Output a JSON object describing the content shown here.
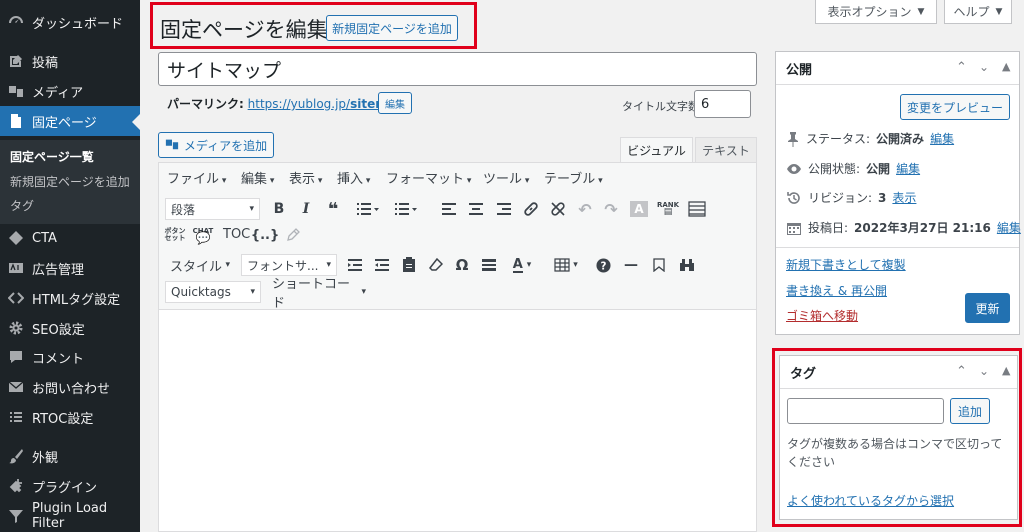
{
  "sidebar": {
    "items": [
      {
        "label": "ダッシュボード",
        "icon": "dashboard-icon"
      },
      {
        "label": "投稿",
        "icon": "posts-icon"
      },
      {
        "label": "メディア",
        "icon": "media-icon"
      },
      {
        "label": "固定ページ",
        "icon": "pages-icon"
      },
      {
        "label": "CTA",
        "icon": "cta-icon"
      },
      {
        "label": "広告管理",
        "icon": "ad-icon"
      },
      {
        "label": "HTMLタグ設定",
        "icon": "code-icon"
      },
      {
        "label": "SEO設定",
        "icon": "gear-icon"
      },
      {
        "label": "コメント",
        "icon": "comment-icon"
      },
      {
        "label": "お問い合わせ",
        "icon": "mail-icon"
      },
      {
        "label": "RTOC設定",
        "icon": "list-icon"
      },
      {
        "label": "外観",
        "icon": "brush-icon"
      },
      {
        "label": "プラグイン",
        "icon": "plugin-icon"
      },
      {
        "label": "Plugin Load Filter",
        "icon": "filter-icon"
      }
    ],
    "submenu": [
      "固定ページ一覧",
      "新規固定ページを追加",
      "タグ"
    ]
  },
  "header": {
    "title": "固定ページを編集",
    "add_new": "新規固定ページを追加",
    "screen_options": "表示オプション",
    "help": "ヘルプ"
  },
  "editor": {
    "post_title": "サイトマップ",
    "permalink_label": "パーマリンク:",
    "permalink_base": "https://yublog.jp/",
    "permalink_slug": "sitemap",
    "permalink_suffix": "/",
    "permalink_edit": "編集",
    "char_count_label": "タイトル文字数:",
    "char_count": "6",
    "add_media": "メディアを追加",
    "tab_visual": "ビジュアル",
    "tab_text": "テキスト",
    "menubar": [
      "ファイル",
      "編集",
      "表示",
      "挿入",
      "フォーマット",
      "ツール",
      "テーブル"
    ],
    "format_select": "段落",
    "toc_label": "TOC",
    "style_select": "スタイル",
    "font_select": "フォントサ...",
    "quicktags_select": "Quicktags",
    "shortcode_label": "ショートコード"
  },
  "publish": {
    "title": "公開",
    "preview": "変更をプレビュー",
    "status_label": "ステータス:",
    "status_value": "公開済み",
    "visibility_label": "公開状態:",
    "visibility_value": "公開",
    "revisions_label": "リビジョン:",
    "revisions_value": "3",
    "revisions_link": "表示",
    "date_label": "投稿日:",
    "date_value": "2022年3月27日 21:16",
    "edit": "編集",
    "copy_draft": "新規下書きとして複製",
    "rewrite": "書き換え & 再公開",
    "trash": "ゴミ箱へ移動",
    "update": "更新"
  },
  "tags": {
    "title": "タグ",
    "add": "追加",
    "input_value": "",
    "description": "タグが複数ある場合はコンマで区切ってください",
    "popular": "よく使われているタグから選択"
  },
  "colors": {
    "sidebar_bg": "#1d2327",
    "active": "#2271b1",
    "highlight_box": "#e0001b",
    "trash": "#b32d2e"
  }
}
